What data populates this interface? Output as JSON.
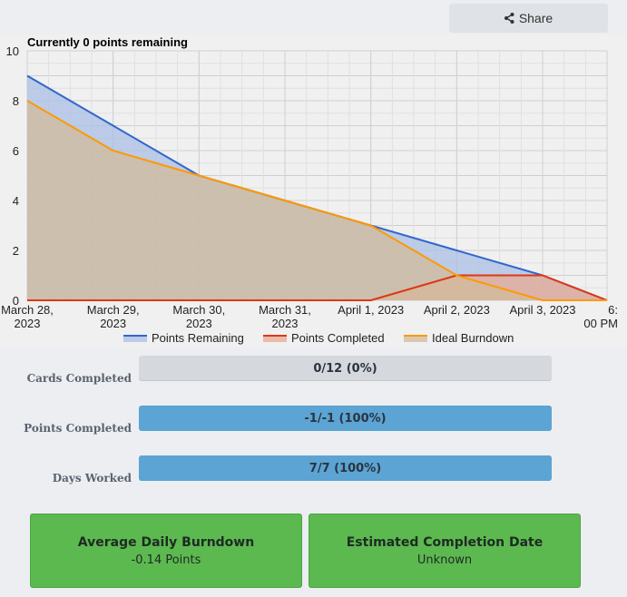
{
  "share": {
    "label": "Share",
    "icon": "share-icon"
  },
  "chart_data": {
    "type": "area",
    "title": "Currently 0 points remaining",
    "x": [
      "2023-03-28 00:00",
      "2023-03-29 00:00",
      "2023-03-30 00:00",
      "2023-03-31 00:00",
      "2023-04-01 00:00",
      "2023-04-02 00:00",
      "2023-04-03 00:00",
      "2023-04-03 18:00"
    ],
    "x_tick_labels": [
      [
        "March 28,",
        "2023"
      ],
      [
        "March 29,",
        "2023"
      ],
      [
        "March 30,",
        "2023"
      ],
      [
        "March 31,",
        "2023"
      ],
      [
        "April 1, 2023"
      ],
      [
        "April 2, 2023"
      ],
      [
        "April 3, 2023"
      ],
      [
        "6:",
        "00 PM"
      ]
    ],
    "ylim": [
      0,
      10
    ],
    "y_ticks": [
      0,
      2,
      4,
      6,
      8,
      10
    ],
    "grid": true,
    "legend_position": "bottom",
    "series": [
      {
        "name": "Points Remaining",
        "color": "#3366cc",
        "fill": "#a9bfe6",
        "values": [
          9,
          7,
          5,
          4,
          3,
          2,
          1,
          0
        ]
      },
      {
        "name": "Points Completed",
        "color": "#dc3912",
        "fill": "#e8a994",
        "values": [
          0,
          0,
          0,
          0,
          0,
          1,
          1,
          0
        ]
      },
      {
        "name": "Ideal Burndown",
        "color": "#ff9900",
        "fill": "#d2bb9b",
        "values": [
          8,
          6,
          5,
          4,
          3,
          1,
          0,
          0
        ]
      }
    ]
  },
  "stats": [
    {
      "label": "Cards Completed",
      "text": "0/12 (0%)",
      "fraction": 0
    },
    {
      "label": "Points Completed",
      "text": "-1/-1 (100%)",
      "fraction": 1
    },
    {
      "label": "Days Worked",
      "text": "7/7 (100%)",
      "fraction": 1
    }
  ],
  "cards": [
    {
      "title": "Average Daily Burndown",
      "value": "-0.14 Points"
    },
    {
      "title": "Estimated Completion Date",
      "value": "Unknown"
    }
  ],
  "colors": {
    "bar_fill": "#5ba4d3",
    "bar_track": "#d5d8dc",
    "card_green": "#5cb950"
  }
}
